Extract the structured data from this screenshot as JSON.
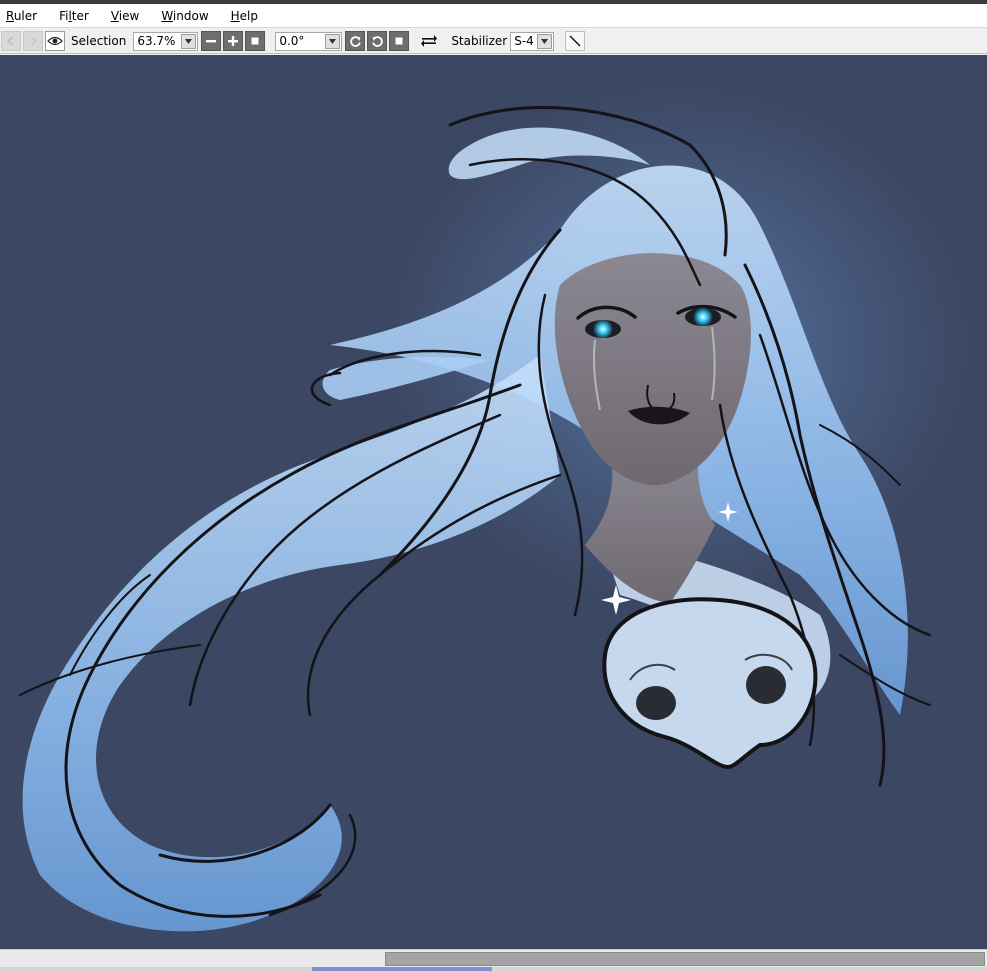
{
  "menu": {
    "items": [
      {
        "pre": "",
        "mn": "R",
        "post": "uler"
      },
      {
        "pre": "Fi",
        "mn": "l",
        "post": "ter"
      },
      {
        "pre": "",
        "mn": "V",
        "post": "iew"
      },
      {
        "pre": "",
        "mn": "W",
        "post": "indow"
      },
      {
        "pre": "",
        "mn": "H",
        "post": "elp"
      }
    ]
  },
  "toolbar": {
    "selection_label": "Selection",
    "zoom_value": "63.7%",
    "rotation_value": "0.0°",
    "stabilizer_label": "Stabilizer",
    "stabilizer_value": "S-4"
  },
  "colors": {
    "canvas_bg": "#3c4763",
    "hair_light": "#b9d6f6",
    "hair_mid": "#7fb1ea",
    "skin": "#7a7681",
    "glow": "#6fa7e8",
    "eye": "#35d0ff",
    "lineart": "#131318"
  },
  "icons": {
    "undo": "undo-icon",
    "redo": "redo-icon",
    "eye": "eye-icon",
    "zoom_out": "minus-icon",
    "zoom_in": "plus-icon",
    "zoom_reset": "square-icon",
    "rotate_ccw": "rotate-left-icon",
    "rotate_cw": "rotate-right-icon",
    "rotate_reset": "square-icon",
    "flip": "flip-horizontal-icon",
    "stroke": "diagonal-line-icon"
  }
}
